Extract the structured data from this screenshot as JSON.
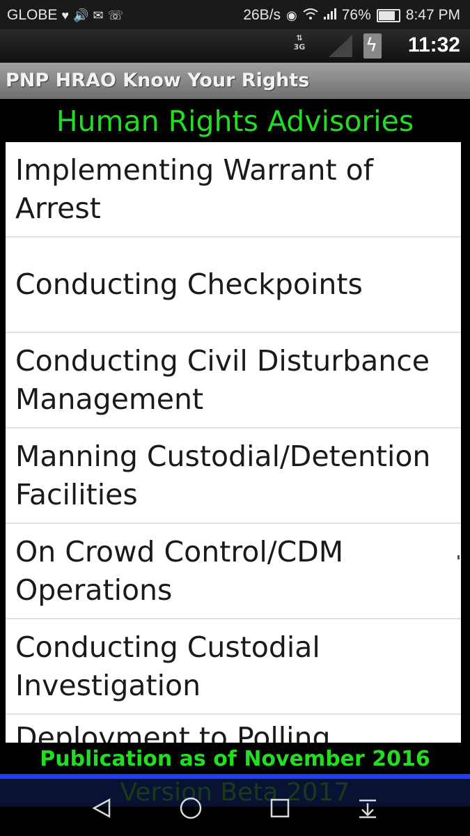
{
  "phone_status": {
    "carrier": "GLOBE",
    "net_speed": "26B/s",
    "battery_percent": "76%",
    "battery_level": 0.76,
    "time": "8:47 PM",
    "left_icons": [
      "heart-icon",
      "volume-icon",
      "mail-icon",
      "viber-icon"
    ],
    "right_icons": [
      "eye-icon",
      "wifi-icon",
      "signal-icon"
    ]
  },
  "emulator_status": {
    "network": "3G",
    "clock": "11:32"
  },
  "app": {
    "title": "PNP HRAO Know Your Rights",
    "heading": "Human Rights Advisories",
    "items": [
      {
        "label": "Implementing Warrant of Arrest"
      },
      {
        "label": "Conducting Checkpoints"
      },
      {
        "label": "Conducting Civil Disturbance Management"
      },
      {
        "label": "Manning Custodial/Detention Facilities"
      },
      {
        "label": "On Crowd Control/CDM Operations"
      },
      {
        "label": "Conducting Custodial Investigation"
      },
      {
        "label": "Deployment to Polling"
      }
    ],
    "footer": "Publication as of November 2016",
    "version": "Version Beta 2017"
  },
  "colors": {
    "accent_green": "#22dd22",
    "blue_line": "#1e3cff"
  },
  "nav": [
    "back-icon",
    "home-icon",
    "recents-icon",
    "notification-pull-icon"
  ]
}
